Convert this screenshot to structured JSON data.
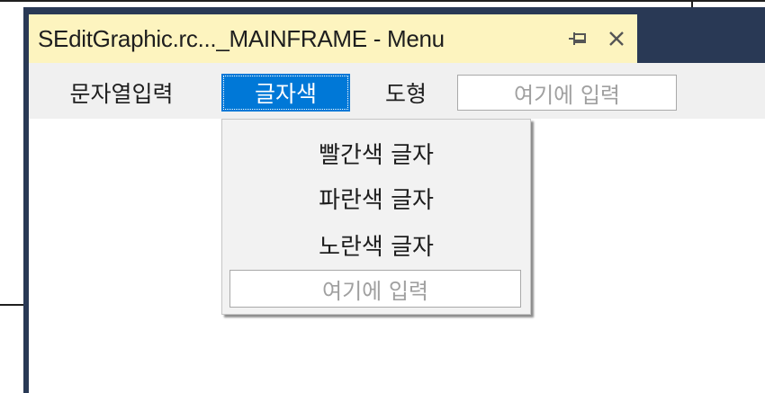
{
  "document_tab": {
    "title": "SEditGraphic.rc..._MAINFRAME - Menu",
    "pin_icon": "pin-icon",
    "close_icon": "close-icon"
  },
  "menubar": {
    "items": [
      {
        "label": "문자열입력",
        "selected": false
      },
      {
        "label": "글자색",
        "selected": true
      },
      {
        "label": "도형",
        "selected": false
      }
    ],
    "type_here": "여기에 입력"
  },
  "dropdown": {
    "items": [
      {
        "label": "빨간색 글자"
      },
      {
        "label": "파란색 글자"
      },
      {
        "label": "노란색 글자"
      }
    ],
    "type_here": "여기에 입력"
  },
  "colors": {
    "frame_background": "#293955",
    "tab_background": "#fdf4bf",
    "selection": "#0078d7",
    "menubar_background": "#f0f0f0",
    "placeholder_text": "#a0a0a0"
  }
}
